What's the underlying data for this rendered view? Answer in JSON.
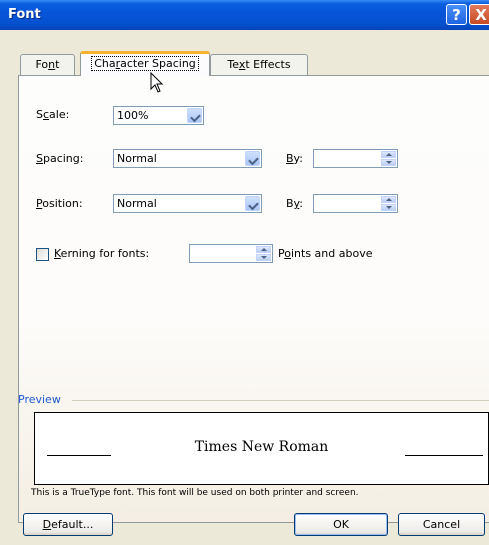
{
  "window": {
    "title": "Font"
  },
  "titlebar_buttons": {
    "help": "?",
    "close": "X"
  },
  "tabs": [
    {
      "label": "Font",
      "accesskey": "n"
    },
    {
      "label": "Character Spacing",
      "accesskey": "r",
      "active": true
    },
    {
      "label": "Text Effects",
      "accesskey": "x"
    }
  ],
  "fields": {
    "scale": {
      "label": "Scale:",
      "value": "100%"
    },
    "spacing": {
      "label": "Spacing:",
      "value": "Normal",
      "by_label": "By:",
      "by_value": ""
    },
    "position": {
      "label": "Position:",
      "value": "Normal",
      "by_label": "By:",
      "by_value": ""
    },
    "kerning": {
      "label": "Kerning for fonts:",
      "checked": false,
      "value": "",
      "suffix": "Points and above"
    }
  },
  "preview": {
    "caption": "Preview",
    "sample_text": "Times New Roman",
    "note": "This is a TrueType font. This font will be used on both printer and screen."
  },
  "buttons": {
    "default": "Default...",
    "ok": "OK",
    "cancel": "Cancel"
  },
  "colors": {
    "titlebar": "#0654d8",
    "accent_tab": "#f5b22f",
    "preview_caption": "#1e5ad6"
  }
}
